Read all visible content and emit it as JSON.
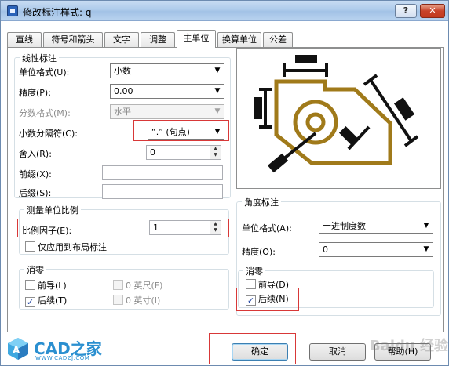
{
  "window": {
    "title": "修改标注样式: q",
    "help_label": "?",
    "close_label": "✕"
  },
  "tabs": [
    "直线",
    "符号和箭头",
    "文字",
    "调整",
    "主单位",
    "换算单位",
    "公差"
  ],
  "linear": {
    "group_title": "线性标注",
    "unit_format_label": "单位格式(U):",
    "unit_format_value": "小数",
    "precision_label": "精度(P):",
    "precision_value": "0.00",
    "fraction_format_label": "分数格式(M):",
    "fraction_format_value": "水平",
    "decimal_sep_label": "小数分隔符(C):",
    "decimal_sep_value": "“.” (句点)",
    "round_off_label": "舍入(R):",
    "round_off_value": "0",
    "prefix_label": "前缀(X):",
    "prefix_value": "",
    "suffix_label": "后缀(S):",
    "suffix_value": ""
  },
  "scale": {
    "group_title": "测量单位比例",
    "scale_factor_label": "比例因子(E):",
    "scale_factor_value": "1",
    "layout_only_label": "仅应用到布局标注"
  },
  "zero_suppress": {
    "group_title": "消零",
    "leading_label": "前导(L)",
    "trailing_label": "后续(T)",
    "feet_label": "0 英尺(F)",
    "inches_label": "0 英寸(I)"
  },
  "angular": {
    "group_title": "角度标注",
    "unit_format_label": "单位格式(A):",
    "unit_format_value": "十进制度数",
    "precision_label": "精度(O):",
    "precision_value": "0",
    "zero_group_title": "消零",
    "leading_label": "前导(D)",
    "trailing_label": "后续(N)"
  },
  "buttons": {
    "ok": "确定",
    "cancel": "取消",
    "help": "帮助(H)"
  },
  "branding": {
    "logo_text": "CAD之家",
    "logo_url": "WWW.CADZJ.COM",
    "watermark": "Baidu 经验"
  },
  "colors": {
    "highlight_box": "#d83838",
    "preview_shape": "#a07a1a",
    "accent": "#2a8fd0"
  }
}
